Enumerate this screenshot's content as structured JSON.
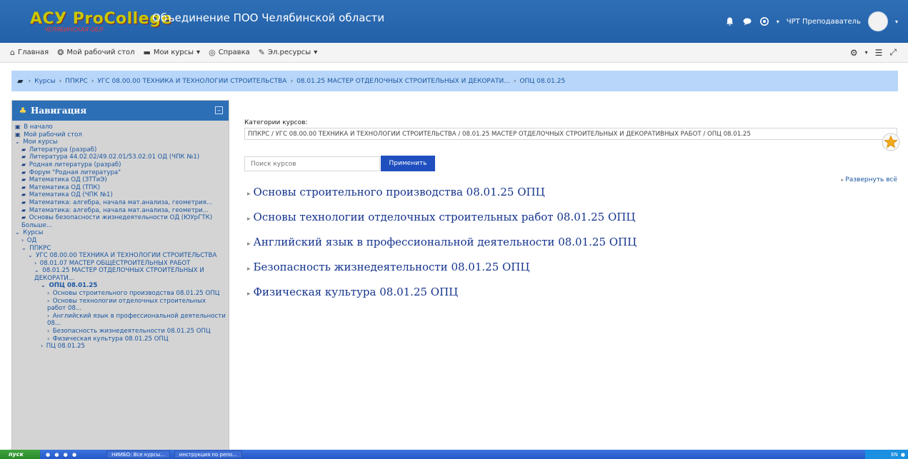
{
  "header": {
    "logo": "АСУ ProCollege",
    "logo_sub": "ЧЕЛЯБИНСКАЯ ОБЛ",
    "site_title": "Объединение ПОО Челябинской области",
    "user_name": "ЧРТ Преподаватель"
  },
  "nav": {
    "home": "Главная",
    "dashboard": "Мой рабочий стол",
    "my_courses": "Мои курсы",
    "help": "Справка",
    "eresources": "Эл.ресурсы"
  },
  "breadcrumb": [
    "Курсы",
    "ППКРС",
    "УГС 08.00.00 ТЕХНИКА И ТЕХНОЛОГИИ СТРОИТЕЛЬСТВА",
    "08.01.25 МАСТЕР ОТДЕЛОЧНЫХ СТРОИТЕЛЬНЫХ И ДЕКОРАТИ...",
    "ОПЦ 08.01.25"
  ],
  "navigation": {
    "title": "Навигация",
    "tree": [
      {
        "text": "В начало",
        "icon": "▣",
        "indent": 0
      },
      {
        "text": "Мой рабочий стол",
        "icon": "▣",
        "indent": 0
      },
      {
        "text": "Мои курсы",
        "icon": "⌄",
        "indent": 0
      },
      {
        "text": "Литература (разраб)",
        "icon": "▰",
        "indent": 1
      },
      {
        "text": "Литература 44.02.02/49.02.01/53.02.01 ОД (ЧПК №1)",
        "icon": "▰",
        "indent": 1
      },
      {
        "text": "Родная литература (разраб)",
        "icon": "▰",
        "indent": 1
      },
      {
        "text": "Форум \"Родная литература\"",
        "icon": "▰",
        "indent": 1
      },
      {
        "text": "Математика ОД (ЗТТиЭ)",
        "icon": "▰",
        "indent": 1
      },
      {
        "text": "Математика ОД (ТПК)",
        "icon": "▰",
        "indent": 1
      },
      {
        "text": "Математика ОД (ЧПК №1)",
        "icon": "▰",
        "indent": 1
      },
      {
        "text": "Математика: алгебра, начала мат.анализа, геометрия...",
        "icon": "▰",
        "indent": 1
      },
      {
        "text": "Математика: алгебра, начала мат.анализа, геометри...",
        "icon": "▰",
        "indent": 1
      },
      {
        "text": "Основы безопасности жизнедеятельности ОД (ЮУрГТК)",
        "icon": "▰",
        "indent": 1
      },
      {
        "text": "Больше...",
        "icon": "",
        "indent": 1
      },
      {
        "text": "Курсы",
        "icon": "⌄",
        "indent": 0
      },
      {
        "text": "ОД",
        "icon": "›",
        "indent": 1
      },
      {
        "text": "ППКРС",
        "icon": "⌄",
        "indent": 1
      },
      {
        "text": "УГС 08.00.00 ТЕХНИКА И ТЕХНОЛОГИИ СТРОИТЕЛЬСТВА",
        "icon": "⌄",
        "indent": 2
      },
      {
        "text": "08.01.07 МАСТЕР ОБЩЕСТРОИТЕЛЬНЫХ РАБОТ",
        "icon": "›",
        "indent": 3
      },
      {
        "text": "08.01.25 МАСТЕР ОТДЕЛОЧНЫХ СТРОИТЕЛЬНЫХ И ДЕКОРАТИ...",
        "icon": "⌄",
        "indent": 3
      },
      {
        "text": "ОПЦ 08.01.25",
        "icon": "⌄",
        "indent": 4,
        "bold": true
      },
      {
        "text": "Основы строительного производства 08.01.25 ОПЦ",
        "icon": "›",
        "indent": 5
      },
      {
        "text": "Основы технологии отделочных строительных работ 08...",
        "icon": "›",
        "indent": 5
      },
      {
        "text": "Английский язык в профессиональной деятельности 08...",
        "icon": "›",
        "indent": 5
      },
      {
        "text": "Безопасность жизнедеятельности 08.01.25 ОПЦ",
        "icon": "›",
        "indent": 5
      },
      {
        "text": "Физическая культура 08.01.25 ОПЦ",
        "icon": "›",
        "indent": 5
      },
      {
        "text": "ПЦ 08.01.25",
        "icon": "›",
        "indent": 4
      }
    ]
  },
  "main": {
    "category_label": "Категории курсов:",
    "category_value": "ППКРС / УГС 08.00.00 ТЕХНИКА И ТЕХНОЛОГИИ СТРОИТЕЛЬСТВА / 08.01.25 МАСТЕР ОТДЕЛОЧНЫХ СТРОИТЕЛЬНЫХ И ДЕКОРАТИВНЫХ РАБОТ / ОПЦ 08.01.25",
    "search_placeholder": "Поиск курсов",
    "apply_label": "Применить",
    "expand_all": "Развернуть всё",
    "courses": [
      "Основы строительного производства 08.01.25 ОПЦ",
      "Основы технологии отделочных строительных работ 08.01.25 ОПЦ",
      "Английский язык в профессиональной деятельности 08.01.25 ОПЦ",
      "Безопасность жизнедеятельности 08.01.25 ОПЦ",
      "Физическая культура 08.01.25 ОПЦ"
    ]
  },
  "taskbar": {
    "start": "пуск",
    "tasks": [
      "НИИБО: Все курсы...",
      "инструкция по репо..."
    ],
    "lang": "EN"
  },
  "colors": {
    "header_blue": "#2f6fb6",
    "breadcrumb_bg": "#b8d6f9",
    "apply_button": "#1f4fbf",
    "course_link": "#14338c"
  }
}
